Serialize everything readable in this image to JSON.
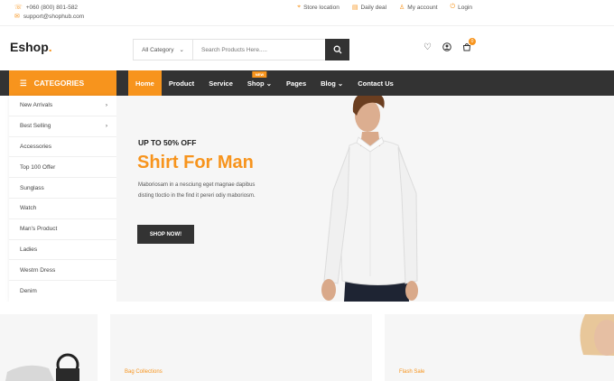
{
  "topbar": {
    "phone": "+060 (800) 801-582",
    "email": "support@shophub.com",
    "links": [
      "Store location",
      "Daily deal",
      "My account",
      "Login"
    ]
  },
  "header": {
    "logo_text": "Eshop",
    "logo_dot": ".",
    "category_select": "All Category",
    "search_placeholder": "Search Products Here.....",
    "cart_count": "0"
  },
  "nav": {
    "categories_label": "CATEGORIES",
    "items": [
      "Home",
      "Product",
      "Service",
      "Shop",
      "Pages",
      "Blog",
      "Contact Us"
    ],
    "shop_badge": "NEW"
  },
  "sidebar": {
    "items": [
      "New Arrivals",
      "Best Selling",
      "Accessories",
      "Top 100 Offer",
      "Sunglass",
      "Watch",
      "Man's Product",
      "Ladies",
      "Westrn Dress",
      "Denim"
    ]
  },
  "hero": {
    "subtitle": "UP TO 50% OFF",
    "title": "Shirt For Man",
    "description": "Maboriosam in a nesciung eget magnae dapibus disting tloctio in the find it pereri odiy maboriosm.",
    "button": "SHOP NOW!"
  },
  "cards": {
    "bag_label": "Bag Collections",
    "flash_label": "Flash Sale"
  },
  "colors": {
    "accent": "#f7941d",
    "dark": "#333333"
  }
}
